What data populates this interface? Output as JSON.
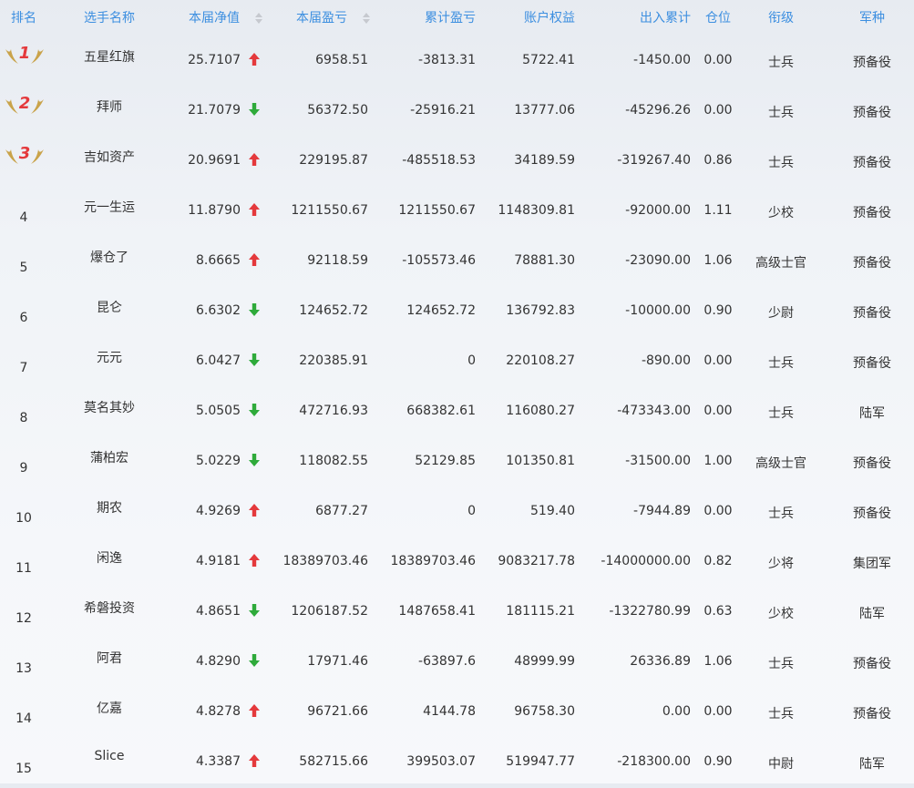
{
  "columns": {
    "rank": "排名",
    "name": "选手名称",
    "nav": "本届净值",
    "pl": "本届盈亏",
    "cum_pl": "累计盈亏",
    "equity": "账户权益",
    "inout": "出入累计",
    "position": "仓位",
    "grade": "衔级",
    "army": "军种"
  },
  "colors": {
    "header": "#3d8fe0",
    "up": "#e4393c",
    "down": "#2eaa3a",
    "medal": "#c9a34a"
  },
  "rows": [
    {
      "rank": "1",
      "medal": true,
      "name": "五星红旗",
      "nav": "25.7107",
      "trend": "up",
      "pl": "6958.51",
      "cum": "-3813.31",
      "eq": "5722.41",
      "io": "-1450.00",
      "pos": "0.00",
      "grade": "士兵",
      "army": "预备役"
    },
    {
      "rank": "2",
      "medal": true,
      "name": "拜师",
      "nav": "21.7079",
      "trend": "down",
      "pl": "56372.50",
      "cum": "-25916.21",
      "eq": "13777.06",
      "io": "-45296.26",
      "pos": "0.00",
      "grade": "士兵",
      "army": "预备役"
    },
    {
      "rank": "3",
      "medal": true,
      "name": "吉如资产",
      "nav": "20.9691",
      "trend": "up",
      "pl": "229195.87",
      "cum": "-485518.53",
      "eq": "34189.59",
      "io": "-319267.40",
      "pos": "0.86",
      "grade": "士兵",
      "army": "预备役"
    },
    {
      "rank": "4",
      "name": "元一生运",
      "nav": "11.8790",
      "trend": "up",
      "pl": "1211550.67",
      "cum": "1211550.67",
      "eq": "1148309.81",
      "io": "-92000.00",
      "pos": "1.11",
      "grade": "少校",
      "army": "预备役"
    },
    {
      "rank": "5",
      "name": "爆仓了",
      "nav": "8.6665",
      "trend": "up",
      "pl": "92118.59",
      "cum": "-105573.46",
      "eq": "78881.30",
      "io": "-23090.00",
      "pos": "1.06",
      "grade": "高级士官",
      "army": "预备役"
    },
    {
      "rank": "6",
      "name": "昆仑",
      "nav": "6.6302",
      "trend": "down",
      "pl": "124652.72",
      "cum": "124652.72",
      "eq": "136792.83",
      "io": "-10000.00",
      "pos": "0.90",
      "grade": "少尉",
      "army": "预备役"
    },
    {
      "rank": "7",
      "name": "元元",
      "nav": "6.0427",
      "trend": "down",
      "pl": "220385.91",
      "cum": "0",
      "eq": "220108.27",
      "io": "-890.00",
      "pos": "0.00",
      "grade": "士兵",
      "army": "预备役"
    },
    {
      "rank": "8",
      "name": "莫名其妙",
      "nav": "5.0505",
      "trend": "down",
      "pl": "472716.93",
      "cum": "668382.61",
      "eq": "116080.27",
      "io": "-473343.00",
      "pos": "0.00",
      "grade": "士兵",
      "army": "陆军"
    },
    {
      "rank": "9",
      "name": "蒲柏宏",
      "nav": "5.0229",
      "trend": "down",
      "pl": "118082.55",
      "cum": "52129.85",
      "eq": "101350.81",
      "io": "-31500.00",
      "pos": "1.00",
      "grade": "高级士官",
      "army": "预备役"
    },
    {
      "rank": "10",
      "name": "期农",
      "nav": "4.9269",
      "trend": "up",
      "pl": "6877.27",
      "cum": "0",
      "eq": "519.40",
      "io": "-7944.89",
      "pos": "0.00",
      "grade": "士兵",
      "army": "预备役"
    },
    {
      "rank": "11",
      "name": "闲逸",
      "nav": "4.9181",
      "trend": "up",
      "pl": "18389703.46",
      "cum": "18389703.46",
      "eq": "9083217.78",
      "io": "-14000000.00",
      "pos": "0.82",
      "grade": "少将",
      "army": "集团军"
    },
    {
      "rank": "12",
      "name": "希磐投资",
      "nav": "4.8651",
      "trend": "down",
      "pl": "1206187.52",
      "cum": "1487658.41",
      "eq": "181115.21",
      "io": "-1322780.99",
      "pos": "0.63",
      "grade": "少校",
      "army": "陆军"
    },
    {
      "rank": "13",
      "name": "阿君",
      "nav": "4.8290",
      "trend": "down",
      "pl": "17971.46",
      "cum": "-63897.6",
      "eq": "48999.99",
      "io": "26336.89",
      "pos": "1.06",
      "grade": "士兵",
      "army": "预备役"
    },
    {
      "rank": "14",
      "name": "亿嘉",
      "nav": "4.8278",
      "trend": "up",
      "pl": "96721.66",
      "cum": "4144.78",
      "eq": "96758.30",
      "io": "0.00",
      "pos": "0.00",
      "grade": "士兵",
      "army": "预备役"
    },
    {
      "rank": "15",
      "name": "Slice",
      "nav": "4.3387",
      "trend": "up",
      "pl": "582715.66",
      "cum": "399503.07",
      "eq": "519947.77",
      "io": "-218300.00",
      "pos": "0.90",
      "grade": "中尉",
      "army": "陆军"
    }
  ]
}
